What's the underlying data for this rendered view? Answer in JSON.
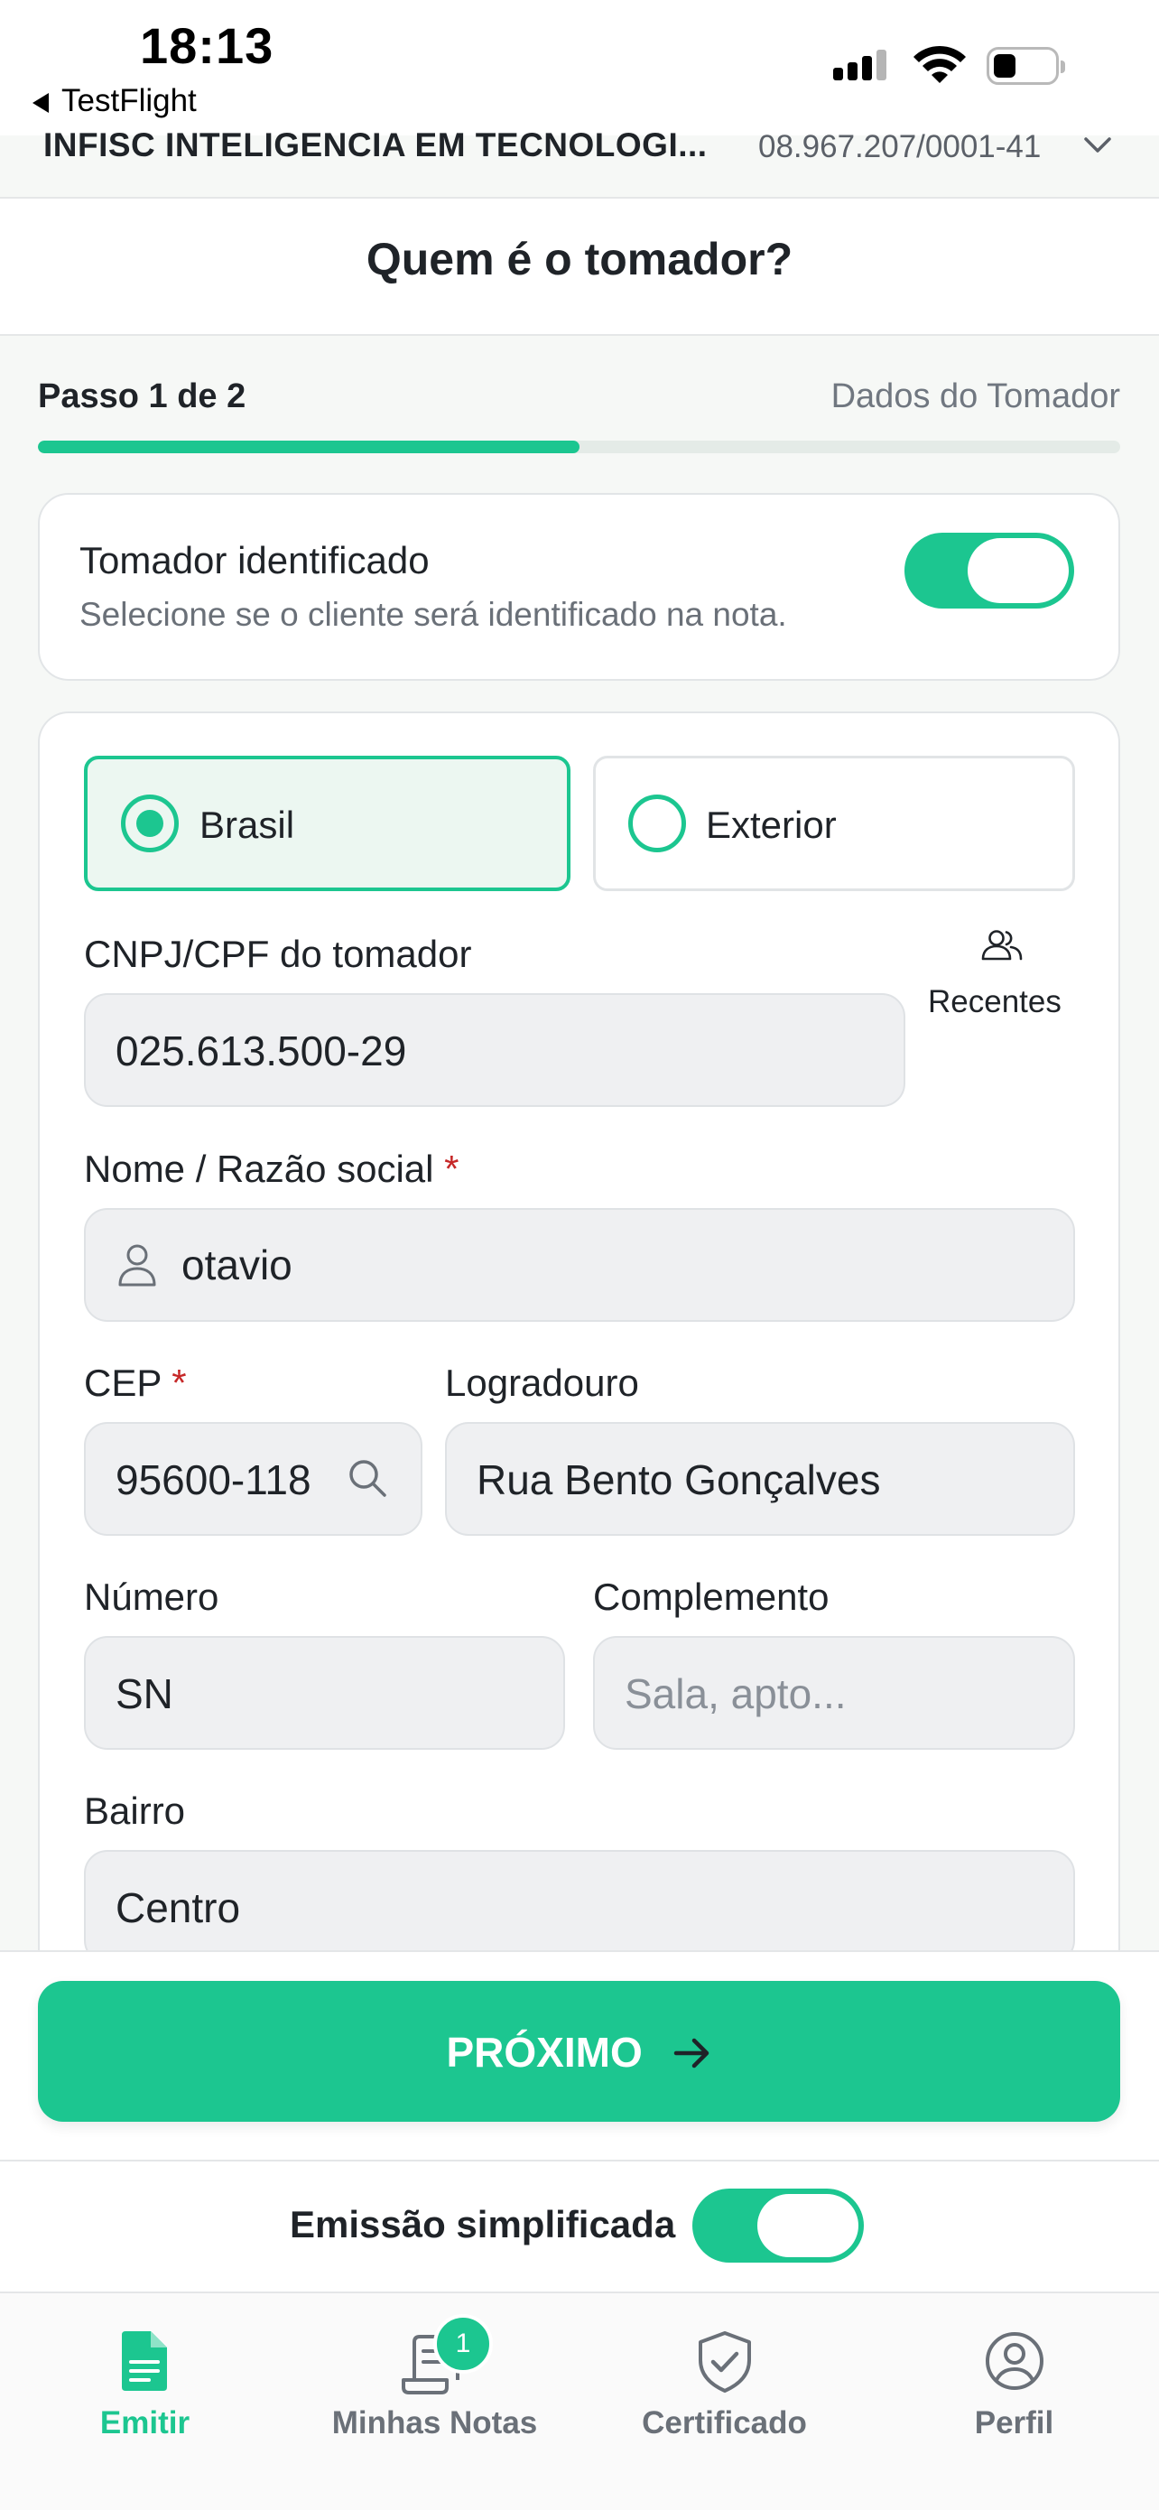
{
  "status_bar": {
    "time": "18:13",
    "back_app": "TestFlight"
  },
  "company": {
    "name": "INFISC INTELIGENCIA EM TECNOLOGI...",
    "cnpj": "08.967.207/0001-41"
  },
  "header": {
    "title": "Quem é o tomador?"
  },
  "progress": {
    "step": "Passo 1 de 2",
    "section": "Dados do Tomador",
    "fraction": 0.5
  },
  "identified": {
    "title": "Tomador identificado",
    "subtitle": "Selecione se o cliente será identificado na nota.",
    "enabled": true
  },
  "location": {
    "options": [
      "Brasil",
      "Exterior"
    ],
    "selected": "Brasil"
  },
  "form": {
    "cnpj_label": "CNPJ/CPF do tomador",
    "cnpj_value": "025.613.500-29",
    "recent_label": "Recentes",
    "name_label": "Nome / Razão social",
    "name_value": "otavio",
    "cep_label": "CEP",
    "cep_value": "95600-118",
    "street_label": "Logradouro",
    "street_value": "Rua Bento Gonçalves",
    "number_label": "Número",
    "number_value": "SN",
    "complement_label": "Complemento",
    "complement_placeholder": "Sala, apto...",
    "district_label": "Bairro",
    "district_value": "Centro",
    "required_mark": "*"
  },
  "actions": {
    "next_label": "PRÓXIMO",
    "simplified_label": "Emissão simplificada",
    "simplified_enabled": true
  },
  "tabs": [
    {
      "label": "Emitir",
      "icon": "document-icon",
      "active": true
    },
    {
      "label": "Minhas Notas",
      "icon": "receipt-icon",
      "badge": "1"
    },
    {
      "label": "Certificado",
      "icon": "shield-check-icon"
    },
    {
      "label": "Perfil",
      "icon": "user-circle-icon"
    }
  ],
  "colors": {
    "accent": "#1cc690",
    "required": "#c62828"
  }
}
